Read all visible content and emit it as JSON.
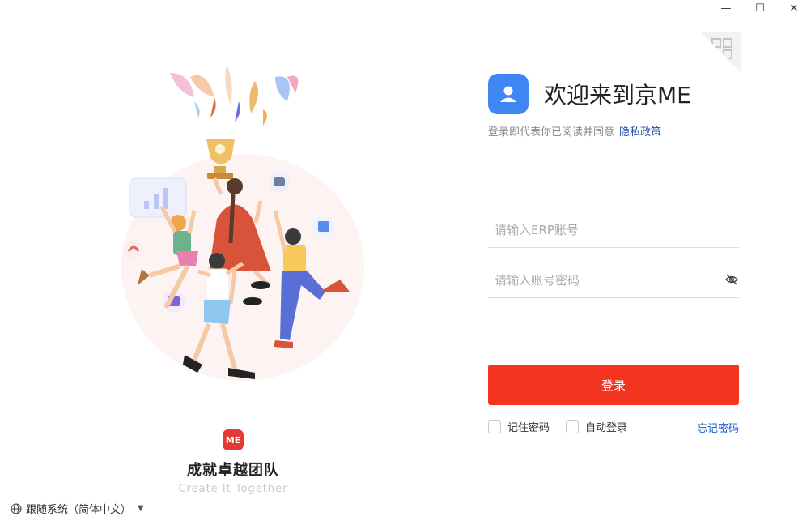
{
  "window": {
    "minimize_glyph": "—",
    "maximize_glyph": "☐",
    "close_glyph": "✕"
  },
  "illustration": {
    "icon": "celebrating-team-trophy-illustration"
  },
  "brand": {
    "logo_text": "ME",
    "slogan": "成就卓越团队",
    "slogan_en": "Create  It Together"
  },
  "language": {
    "label": "跟随系统（简体中文）",
    "icon": "globe-icon"
  },
  "login": {
    "qr_icon": "qr-code-corner-icon",
    "app_icon": "user-avatar-icon",
    "welcome": "欢迎来到京ME",
    "agree_text": "登录即代表你已阅读并同意",
    "privacy_link": "隐私政策",
    "account_placeholder": "请输入ERP账号",
    "password_placeholder": "请输入账号密码",
    "password_eye_icon": "eye-hidden-icon",
    "submit": "登录",
    "remember": "记住密码",
    "auto_login": "自动登录",
    "forgot": "忘记密码"
  },
  "colors": {
    "primary_button": "#f5341f",
    "app_icon_bg": "#3f86f5",
    "link": "#1e62c8"
  }
}
